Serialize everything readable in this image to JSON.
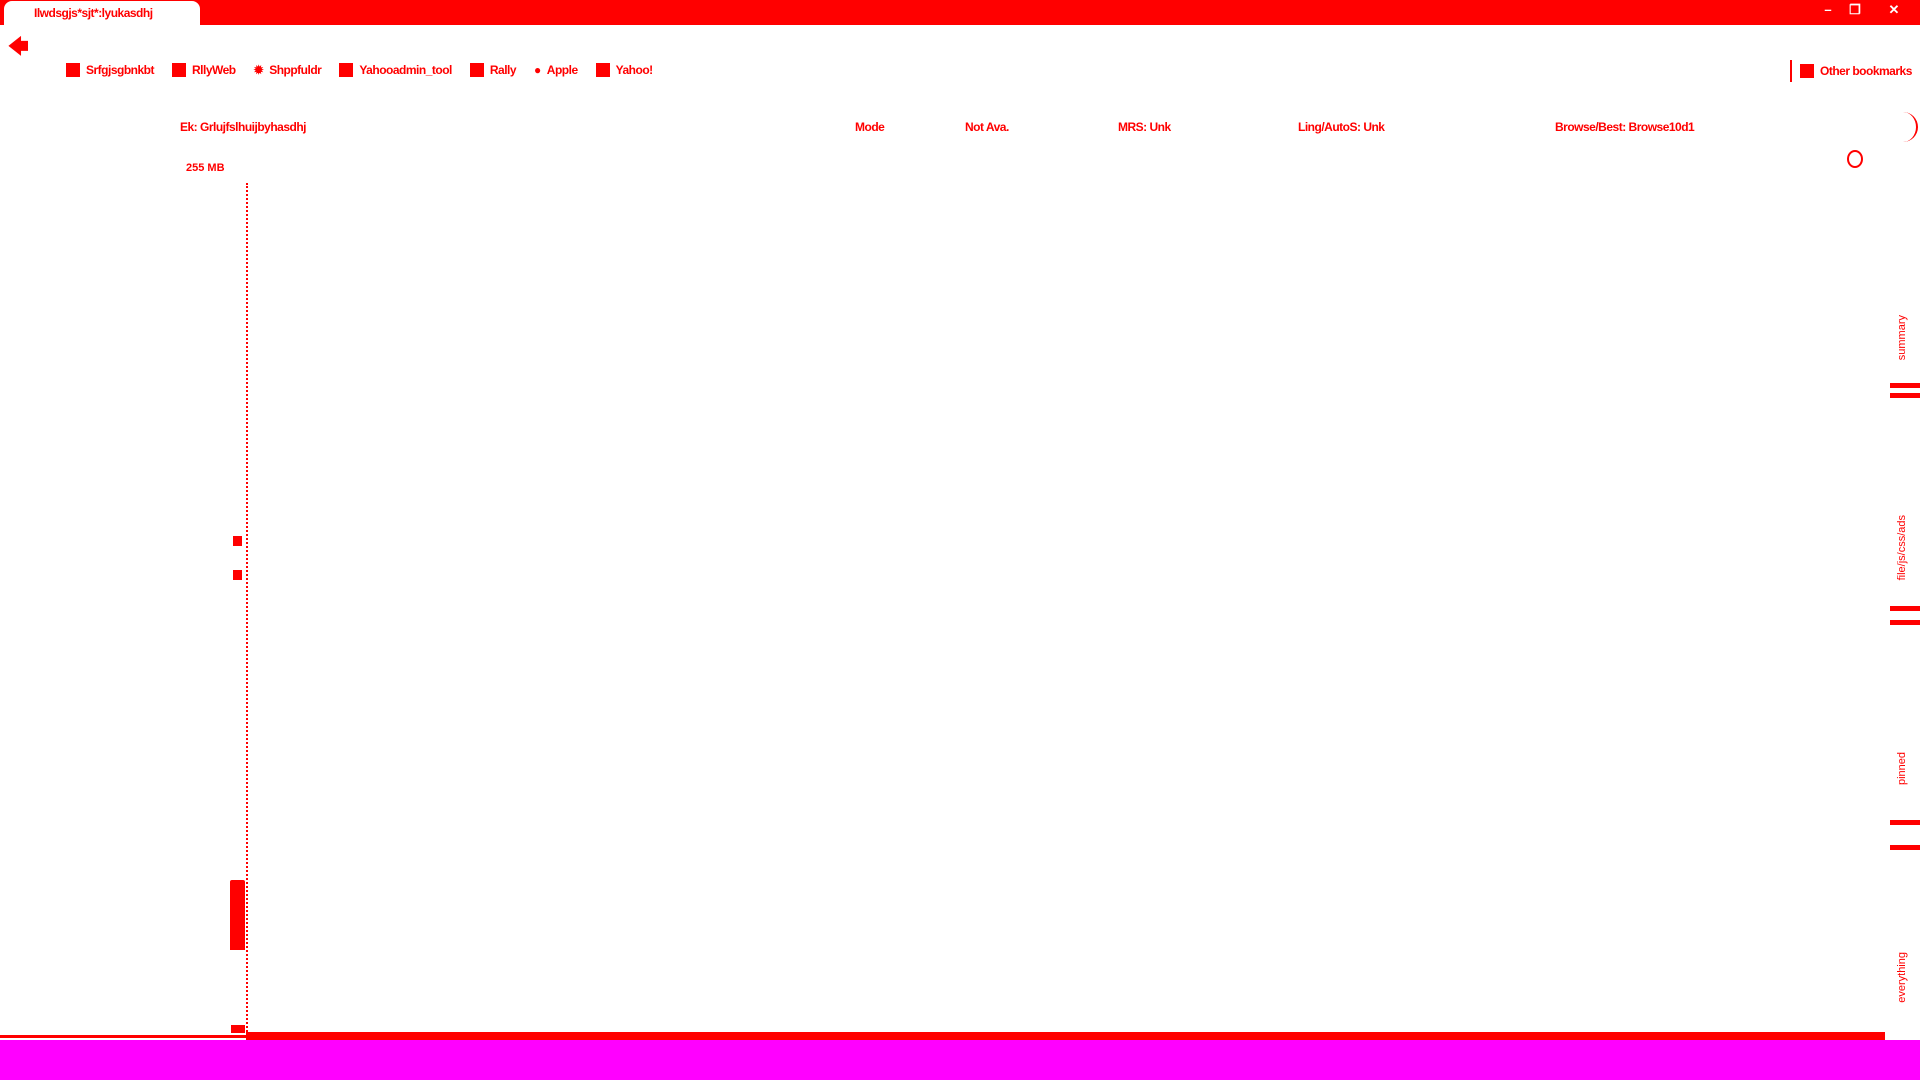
{
  "browser": {
    "tab_title": "Ilwdsgjs*sjt*:lyukasdhj",
    "window_buttons": [
      "–",
      "❐",
      "✕"
    ],
    "bookmarks": [
      {
        "label": "Srfgjsgbnkbt",
        "icon": "puzzle-icon"
      },
      {
        "label": "RllyWeb",
        "icon": "page-icon"
      },
      {
        "label": "Shppfuldr",
        "icon": "gear-icon"
      },
      {
        "label": "Yahooadmin_tool",
        "icon": "page-icon"
      },
      {
        "label": "Rally",
        "icon": "page-icon"
      },
      {
        "label": "Apple",
        "icon": "apple-icon"
      },
      {
        "label": "Yahoo!",
        "icon": "page-icon"
      }
    ],
    "other_bookmarks": "Other bookmarks"
  },
  "header": {
    "title": "Ek: Grlujfslhuijbyhasdhj",
    "mode": "Mode",
    "availability": "Not Ava.",
    "mrs": "MRS: Unk",
    "ling": "Ling/AutoS: Unk",
    "browse": "Browse/Best: Browse10d1"
  },
  "chart": {
    "memory_label": "255 MB"
  },
  "side_tabs": [
    "summary",
    "file/js/css/ads",
    "pinned",
    "everything"
  ],
  "colors": {
    "accent": "#ff0000",
    "status_bar": "#ff00ff"
  }
}
